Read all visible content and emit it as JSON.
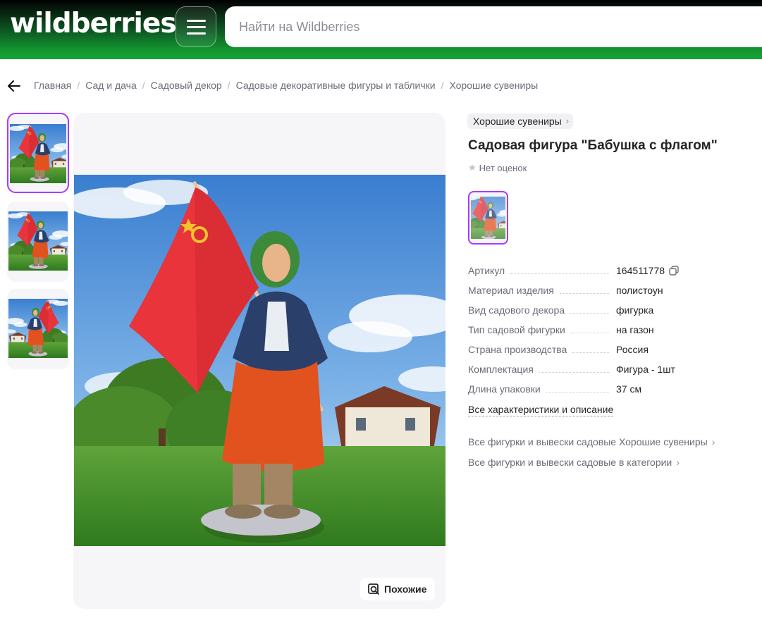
{
  "header": {
    "logo_text": "wildberries",
    "search_placeholder": "Найти на Wildberries"
  },
  "breadcrumbs": [
    "Главная",
    "Сад и дача",
    "Садовый декор",
    "Садовые декоративные фигуры и таблички",
    "Хорошие сувениры"
  ],
  "gallery": {
    "thumbnails": [
      "front-view",
      "side-view",
      "back-view"
    ],
    "active_index": 0,
    "similar_label": "Похожие"
  },
  "product": {
    "brand": "Хорошие сувениры",
    "title": "Садовая фигура \"Бабушка с флагом\"",
    "rating_text": "Нет оценок",
    "specs": [
      {
        "label": "Артикул",
        "value": "164511778"
      },
      {
        "label": "Материал изделия",
        "value": "полистоун"
      },
      {
        "label": "Вид садового декора",
        "value": "фигурка"
      },
      {
        "label": "Тип садовой фигурки",
        "value": "на газон"
      },
      {
        "label": "Страна производства",
        "value": "Россия"
      },
      {
        "label": "Комплектация",
        "value": "Фигура - 1шт"
      },
      {
        "label": "Длина упаковки",
        "value": "37 см"
      }
    ],
    "all_specs_link": "Все характеристики и описание",
    "links": [
      "Все фигурки и вывески садовые Хорошие сувениры",
      "Все фигурки и вывески садовые в категории"
    ]
  },
  "colors": {
    "accent": "#a73afd",
    "header_green": "#16a534",
    "text_primary": "#242424",
    "text_secondary": "#6b6b78"
  }
}
